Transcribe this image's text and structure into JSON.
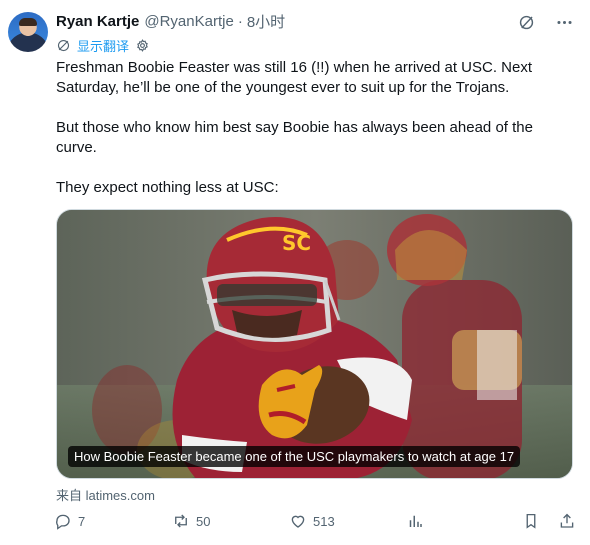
{
  "author": {
    "name": "Ryan Kartje",
    "handle": "@RyanKartje",
    "separator": "·",
    "time": "8小时"
  },
  "translate": {
    "label": "显示翻译"
  },
  "tweet": {
    "paragraphs": [
      "Freshman Boobie Feaster was still 16 (!!) when he arrived at USC. Next Saturday, he’ll be one of the youngest ever to suit up for the Trojans.",
      "But those who know him best say Boobie has always been ahead of the curve.",
      "They expect nothing less at USC:"
    ]
  },
  "media": {
    "caption": "How Boobie Feaster became one of the USC playmakers to watch at age 17",
    "helmet_logo": "SC"
  },
  "source": {
    "label": "来自 latimes.com"
  },
  "actions": {
    "replies": "7",
    "reposts": "50",
    "likes": "513",
    "views": ""
  },
  "icons": {
    "grok": "grok-slash-icon",
    "more": "more-dots-icon",
    "translate": "translate-globe-icon",
    "settings": "gear-icon",
    "reply": "reply-bubble-icon",
    "repost": "repost-arrows-icon",
    "like": "heart-icon",
    "views": "bar-chart-icon",
    "bookmark": "bookmark-icon",
    "share": "share-icon"
  },
  "colors": {
    "text": "#0f1419",
    "secondary": "#536471",
    "link": "#1d9bf0",
    "usc_cardinal": "#9d2235",
    "usc_gold": "#ffc72c"
  }
}
